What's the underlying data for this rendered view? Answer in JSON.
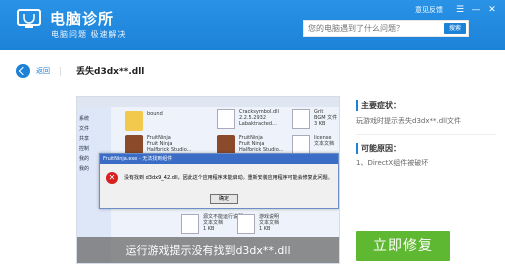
{
  "header": {
    "title": "电脑诊所",
    "slogan": "电脑问题 极速解决",
    "search_placeholder": "您的电脑遇到了什么问题？",
    "search_button": "搜索",
    "feedback_link": "意见反馈",
    "accent_color": "#1c82d8"
  },
  "nav": {
    "back_label": "返回",
    "page_title": "丢失d3dx**.dll"
  },
  "screenshot": {
    "sidebar_items": [
      "系统",
      "文件",
      "共享",
      "控制",
      "我的",
      "我的"
    ],
    "files": [
      {
        "name": "bound",
        "type": "folder"
      },
      {
        "name": "Cracksymbol.dll\n2.2.5.2932\nLabaktracted...",
        "type": "doc"
      },
      {
        "name": "Grit\nBGM 文件\n3 KB",
        "type": "doc"
      },
      {
        "name": "FruitNinja\nFruit Ninja\nHalfbrick Studio...",
        "type": "game"
      },
      {
        "name": "FruitNinja\nFruit Ninja\nHalfbrick Studio...",
        "type": "game"
      },
      {
        "name": "license\n文本文档",
        "type": "doc"
      },
      {
        "name": "源文不能运行说明.txt\n文本文档\n1 KB",
        "type": "doc"
      },
      {
        "name": "游戏说明\n文本文档\n1 KB",
        "type": "doc"
      }
    ],
    "dialog_title": "FruitNinja.exe - 无法找到组件",
    "dialog_message": "没有找到 d3dx9_42.dll，因此这个应用程序未能启动。重新安装应用程序可能会修复此问题。",
    "dialog_ok": "确定",
    "caption": "运行游戏提示没有找到d3dx**.dll"
  },
  "info": {
    "symptom_heading": "主要症状：",
    "symptom_text": "玩游戏时提示丢失d3dx**.dll文件",
    "cause_heading": "可能原因：",
    "cause_items": [
      "1、DirectX组件被破坏"
    ],
    "repair_button": "立即修复",
    "repair_color": "#5fb832"
  }
}
